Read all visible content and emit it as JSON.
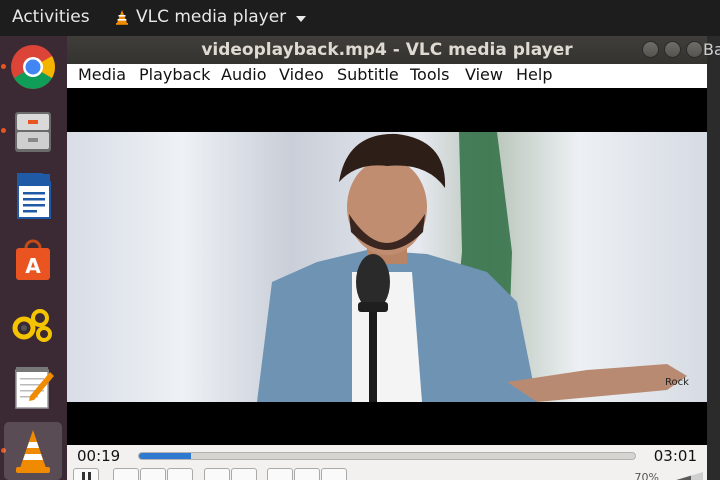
{
  "topbar": {
    "activities": "Activities",
    "app_name": "VLC media player"
  },
  "dock": {
    "items": [
      {
        "name": "Chrome",
        "icon": "chrome-icon",
        "running": true,
        "active": false
      },
      {
        "name": "Files",
        "icon": "file-cabinet-icon",
        "running": true,
        "active": false
      },
      {
        "name": "LibreOffice Writer",
        "icon": "writer-document-icon",
        "running": false,
        "active": false
      },
      {
        "name": "Ubuntu Software",
        "icon": "shopping-bag-icon",
        "running": false,
        "active": false
      },
      {
        "name": "Settings",
        "icon": "gears-icon",
        "running": false,
        "active": false
      },
      {
        "name": "Text Editor",
        "icon": "notepad-pencil-icon",
        "running": false,
        "active": false
      },
      {
        "name": "VLC",
        "icon": "vlc-cone-icon",
        "running": true,
        "active": true
      }
    ]
  },
  "window": {
    "title": "videoplayback.mp4 - VLC media player",
    "right_edge_text": "Ba"
  },
  "menu": [
    "Media",
    "Playback",
    "Audio",
    "Video",
    "Subtitle",
    "Tools",
    "View",
    "Help"
  ],
  "video": {
    "watermark": "Rock"
  },
  "controls": {
    "elapsed": "00:19",
    "total": "03:01",
    "progress_fraction": 0.105,
    "volume": "70%"
  },
  "colors": {
    "accent": "#2f79d0",
    "ubuntu_orange": "#e95420",
    "vlc_orange": "#f08a00"
  }
}
